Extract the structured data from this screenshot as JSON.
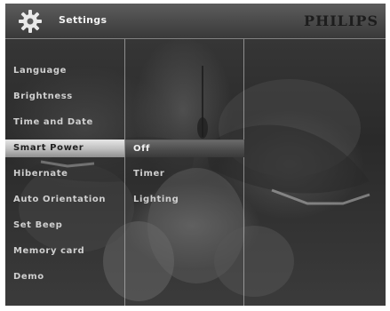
{
  "header": {
    "title": "Settings",
    "brand": "PHILIPS",
    "icon": "gear-icon"
  },
  "menu": {
    "items": [
      {
        "label": "Language"
      },
      {
        "label": "Brightness"
      },
      {
        "label": "Time and Date"
      },
      {
        "label": "Smart Power",
        "selected": true
      },
      {
        "label": "Hibernate"
      },
      {
        "label": "Auto Orientation"
      },
      {
        "label": "Set Beep"
      },
      {
        "label": "Memory card"
      },
      {
        "label": "Demo"
      }
    ]
  },
  "submenu": {
    "items": [
      {
        "label": "Off",
        "selected": true
      },
      {
        "label": "Timer"
      },
      {
        "label": "Lighting"
      }
    ]
  },
  "colors": {
    "selected_highlight": "#d8d8d8",
    "text": "#cfcfcf",
    "brand_text": "#1d1d1d"
  }
}
